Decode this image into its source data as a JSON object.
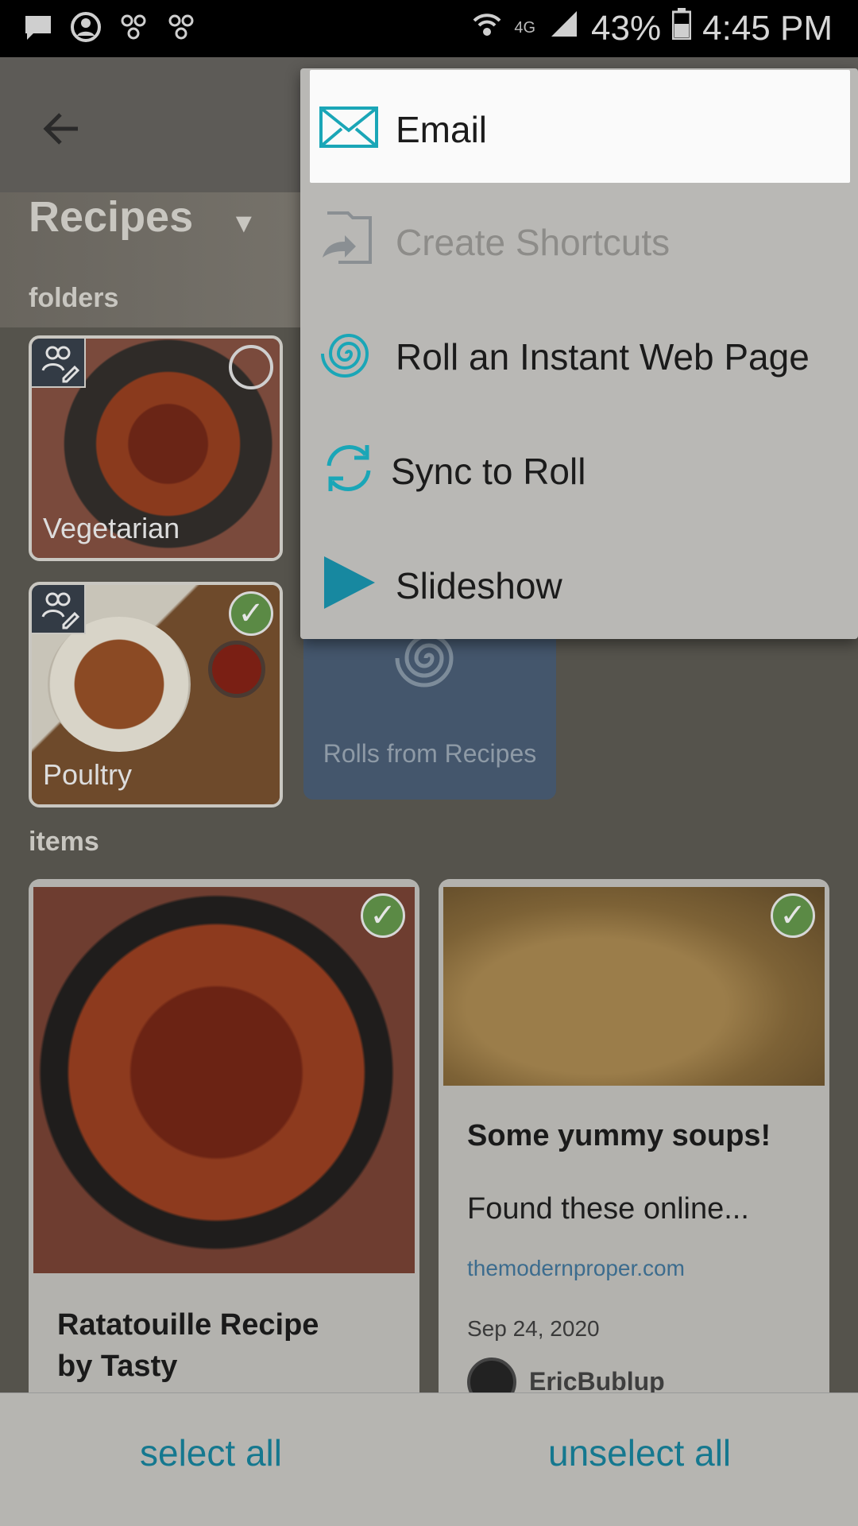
{
  "status_bar": {
    "network_label": "4G",
    "battery": "43%",
    "time": "4:45 PM"
  },
  "header": {
    "title": "Recipes"
  },
  "sections": {
    "folders_label": "folders",
    "items_label": "items"
  },
  "folders": [
    {
      "name": "Vegetarian",
      "selected": false
    },
    {
      "name": "Poultry",
      "selected": true
    }
  ],
  "rolls_tile": {
    "label": "Rolls from Recipes"
  },
  "items": [
    {
      "title": "Ratatouille Recipe by Tasty",
      "title_line1": "Ratatouille Recipe",
      "title_line2": "by Tasty",
      "selected": true
    },
    {
      "title": "Some yummy soups!",
      "text": "Found these online...",
      "link": "themodernproper.com",
      "date": "Sep 24, 2020",
      "user": "EricBublup",
      "selected": true
    }
  ],
  "menu": {
    "items": [
      {
        "label": "Email",
        "icon": "envelope-icon",
        "state": "highlighted"
      },
      {
        "label": "Create Shortcuts",
        "icon": "shortcut-icon",
        "state": "disabled"
      },
      {
        "label": "Roll an Instant Web Page",
        "icon": "spiral-icon",
        "state": "enabled"
      },
      {
        "label": "Sync to Roll",
        "icon": "sync-icon",
        "state": "enabled"
      },
      {
        "label": "Slideshow",
        "icon": "play-icon",
        "state": "enabled"
      }
    ]
  },
  "bottom_bar": {
    "select_all": "select all",
    "unselect_all": "unselect all"
  },
  "colors": {
    "accent": "#1AA6B7",
    "selected_check": "#5b8a45"
  }
}
